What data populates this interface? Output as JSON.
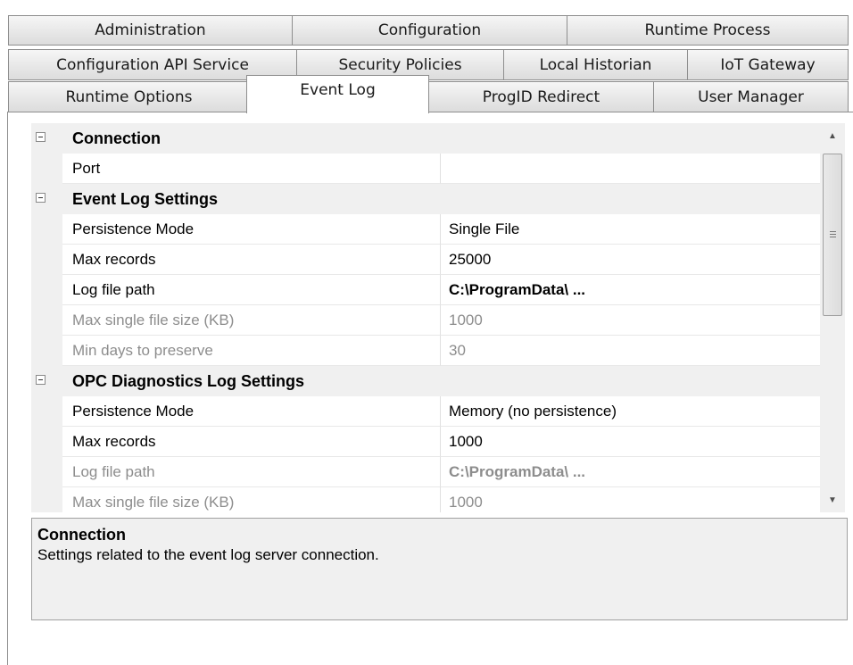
{
  "tabs": {
    "row1": [
      "Administration",
      "Configuration",
      "Runtime Process"
    ],
    "row2": [
      "Configuration API Service",
      "Security Policies",
      "Local Historian",
      "IoT Gateway"
    ],
    "row3": [
      "Runtime Options",
      "Event Log",
      "ProgID Redirect",
      "User Manager"
    ],
    "active": "Event Log"
  },
  "grid": {
    "categories": [
      {
        "label": "Connection",
        "properties": [
          {
            "name": "Port",
            "value": "",
            "disabled": false,
            "bold": false
          }
        ]
      },
      {
        "label": "Event Log Settings",
        "properties": [
          {
            "name": "Persistence Mode",
            "value": "Single File",
            "disabled": false,
            "bold": false
          },
          {
            "name": "Max records",
            "value": "25000",
            "disabled": false,
            "bold": false
          },
          {
            "name": "Log file path",
            "value": "C:\\ProgramData\\ ...",
            "disabled": false,
            "bold": true
          },
          {
            "name": "Max single file size (KB)",
            "value": "1000",
            "disabled": true,
            "bold": false
          },
          {
            "name": "Min days to preserve",
            "value": "30",
            "disabled": true,
            "bold": false
          }
        ]
      },
      {
        "label": "OPC Diagnostics Log Settings",
        "properties": [
          {
            "name": "Persistence Mode",
            "value": "Memory (no persistence)",
            "disabled": false,
            "bold": false
          },
          {
            "name": "Max records",
            "value": "1000",
            "disabled": false,
            "bold": false
          },
          {
            "name": "Log file path",
            "value": "C:\\ProgramData\\ ...",
            "disabled": true,
            "bold": true
          },
          {
            "name": "Max single file size (KB)",
            "value": "1000",
            "disabled": true,
            "bold": false
          }
        ]
      }
    ]
  },
  "scrollbar": {
    "up_icon": "scroll-up-arrow",
    "down_icon": "scroll-down-arrow"
  },
  "description": {
    "title": "Connection",
    "text": "Settings related to the event log server connection."
  }
}
